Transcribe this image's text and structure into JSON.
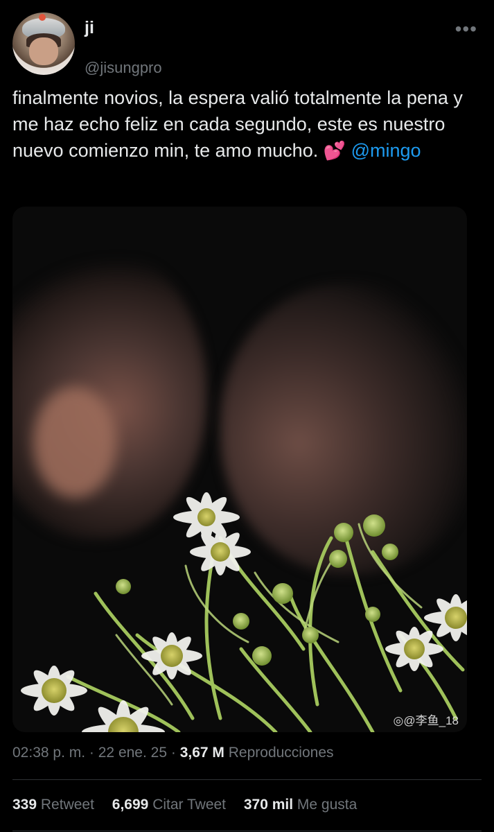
{
  "user": {
    "display_name": "ji",
    "handle": "@jisungpro"
  },
  "tweet": {
    "text": "finalmente novios, la espera valió totalmente la pena y me haz echo feliz en cada segundo, este es nuestro nuevo comienzo min, te amo mucho.",
    "emoji": "💕",
    "mention": "@mingo"
  },
  "media": {
    "watermark": "◎@李鱼_18"
  },
  "meta": {
    "time": "02:38 p. m.",
    "separator": "·",
    "date": "22 ene. 25",
    "views_count": "3,67 M",
    "views_label": "Reproducciones"
  },
  "stats": {
    "retweets_count": "339",
    "retweets_label": "Retweet",
    "quotes_count": "6,699",
    "quotes_label": "Citar Tweet",
    "likes_count": "370 mil",
    "likes_label": "Me gusta"
  },
  "icons": {
    "more": "more-horizontal-icon"
  },
  "colors": {
    "background": "#000000",
    "text": "#e7e9ea",
    "secondary": "#71767b",
    "link": "#1d9bf0",
    "divider": "#2f3336"
  }
}
